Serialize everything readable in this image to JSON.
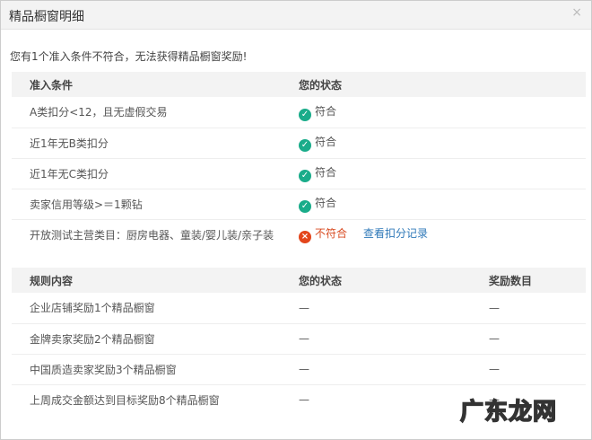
{
  "dialog": {
    "title": "精品橱窗明细",
    "close_icon": "×"
  },
  "message": "您有1个准入条件不符合，无法获得精品橱窗奖励!",
  "criteria": {
    "headers": [
      "准入条件",
      "您的状态"
    ],
    "rows": [
      {
        "label": "A类扣分<12，且无虚假交易",
        "status": "符合",
        "ok": true
      },
      {
        "label": "近1年无B类扣分",
        "status": "符合",
        "ok": true
      },
      {
        "label": "近1年无C类扣分",
        "status": "符合",
        "ok": true
      },
      {
        "label": "卖家信用等级>＝1颗钻",
        "status": "符合",
        "ok": true
      },
      {
        "label": "开放测试主营类目：厨房电器、童装/婴儿装/亲子装",
        "status": "不符合",
        "ok": false,
        "link": "查看扣分记录"
      }
    ]
  },
  "rules": {
    "headers": [
      "规则内容",
      "您的状态",
      "奖励数目"
    ],
    "rows": [
      {
        "label": "企业店铺奖励1个精品橱窗",
        "status": "—",
        "reward": "—"
      },
      {
        "label": "金牌卖家奖励2个精品橱窗",
        "status": "—",
        "reward": "—"
      },
      {
        "label": "中国质造卖家奖励3个精品橱窗",
        "status": "—",
        "reward": "—"
      },
      {
        "label": "上周成交金额达到目标奖励8个精品橱窗",
        "status": "—",
        "reward": "—"
      }
    ]
  },
  "watermark": "广东龙网"
}
